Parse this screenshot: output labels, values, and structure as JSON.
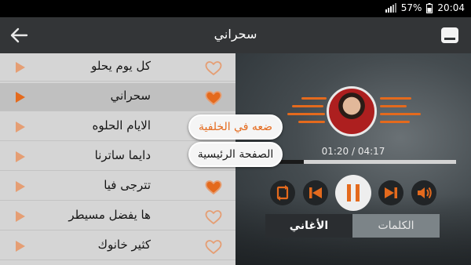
{
  "status": {
    "signal": "signal-bars-icon",
    "battery": "57%",
    "time": "20:04"
  },
  "header": {
    "title": "سحراني",
    "back_icon": "arrow-left-icon",
    "minimize_icon": "minimize-window-icon"
  },
  "songs": [
    {
      "title": "كل يوم يحلو",
      "favorited": false,
      "active": false
    },
    {
      "title": "سحراني",
      "favorited": true,
      "active": true
    },
    {
      "title": "الايام الحلوه",
      "favorited": false,
      "active": false
    },
    {
      "title": "دايما ساترنا",
      "favorited": false,
      "active": false
    },
    {
      "title": "تترجى فيا",
      "favorited": true,
      "active": false
    },
    {
      "title": "ها يفضل مسيطر",
      "favorited": false,
      "active": false
    },
    {
      "title": "كثير خانوك",
      "favorited": false,
      "active": false
    }
  ],
  "menu": {
    "play_in_background": "ضعه في الخلفية",
    "home_page": "الصفحة الرئيسية"
  },
  "player": {
    "time_display": "01:20 / 04:17",
    "progress": 0.31,
    "controls": [
      "repeat-icon",
      "previous-icon",
      "pause-icon",
      "next-icon",
      "volume-icon"
    ]
  },
  "tabs": {
    "songs": "الأغاني",
    "lyrics": "الكلمات",
    "selected": "songs"
  },
  "colors": {
    "accent": "#e46a1d",
    "list_bg": "#d5d5d5",
    "app_bar": "#333537",
    "player_bg": "#454c50"
  }
}
